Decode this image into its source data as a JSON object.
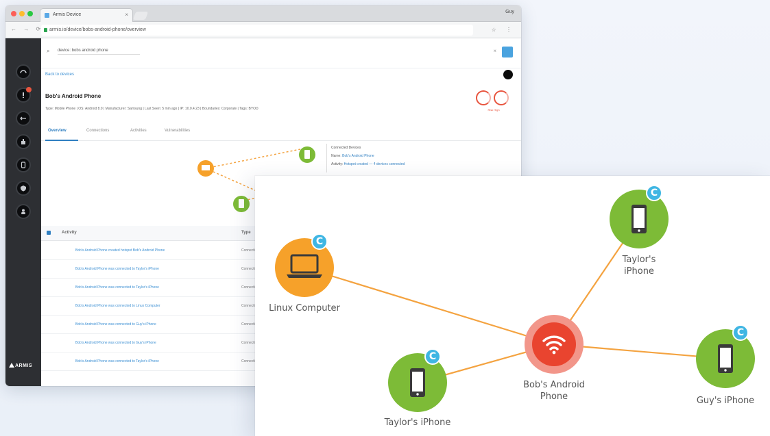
{
  "browser": {
    "tab_title": "Armis Device",
    "tab_close": "×",
    "user_label": "Guy",
    "nav_glyphs": "← → ⟳",
    "url": "armis.io/device/bobs-android-phone/overview",
    "tools": "☆ ⋮"
  },
  "app": {
    "brand": "ARMIS",
    "search": {
      "icon": "⌕",
      "value": "device: bobs android phone",
      "clear": "×"
    },
    "breadcrumb": "Back to devices",
    "device": {
      "title": "Bob's Android Phone",
      "meta": "Type: Mobile Phone | OS: Android 8.0 | Manufacturer: Samsung | Last Seen: 5 min ago | IP: 10.0.4.23 | Boundaries: Corporate | Tags: BYOD",
      "risk_caption": "Risk   High"
    },
    "tabs": [
      "Overview",
      "Connections",
      "Activities",
      "Vulnerabilities"
    ],
    "mini_info": {
      "title": "Connected Devices",
      "line1_label": "Name:",
      "line1_value": "Bob's Android Phone",
      "line2_label": "Activity:",
      "line2_value": "Hotspot created — 4 devices connected"
    },
    "table": {
      "headers": [
        "Activity",
        "Type"
      ],
      "rows": [
        {
          "text": "Bob's Android Phone created hotspot Bob's Android Phone",
          "status": "Connection"
        },
        {
          "text": "Bob's Android Phone was connected to Taylor's iPhone",
          "status": "Connection"
        },
        {
          "text": "Bob's Android Phone was connected to Taylor's iPhone",
          "status": "Connection"
        },
        {
          "text": "Bob's Android Phone was connected to Linux Computer",
          "status": "Connection"
        },
        {
          "text": "Bob's Android Phone was connected to Guy's iPhone",
          "status": "Connection"
        },
        {
          "text": "Bob's Android Phone was connected to Guy's iPhone",
          "status": "Connection"
        },
        {
          "text": "Bob's Android Phone was connected to Taylor's iPhone",
          "status": "Connection"
        }
      ]
    }
  },
  "graph": {
    "colors": {
      "link": "#f4a340",
      "phone_node": "#7dbb37",
      "laptop_node": "#f6a12a",
      "hub_node": "#e9442f",
      "badge": "#3fb6e3"
    },
    "badge_letter": "C",
    "nodes": {
      "laptop": {
        "label": "Linux Computer",
        "icon": "laptop-icon"
      },
      "phone_top": {
        "label_line1": "Taylor's",
        "label_line2": "iPhone",
        "icon": "smartphone-icon"
      },
      "hub": {
        "label_line1": "Bob's Android",
        "label_line2": "Phone",
        "icon": "wifi-icon"
      },
      "phone_bottom": {
        "label": "Taylor's iPhone",
        "icon": "smartphone-icon"
      },
      "phone_right": {
        "label": "Guy's iPhone",
        "icon": "smartphone-icon"
      }
    }
  }
}
